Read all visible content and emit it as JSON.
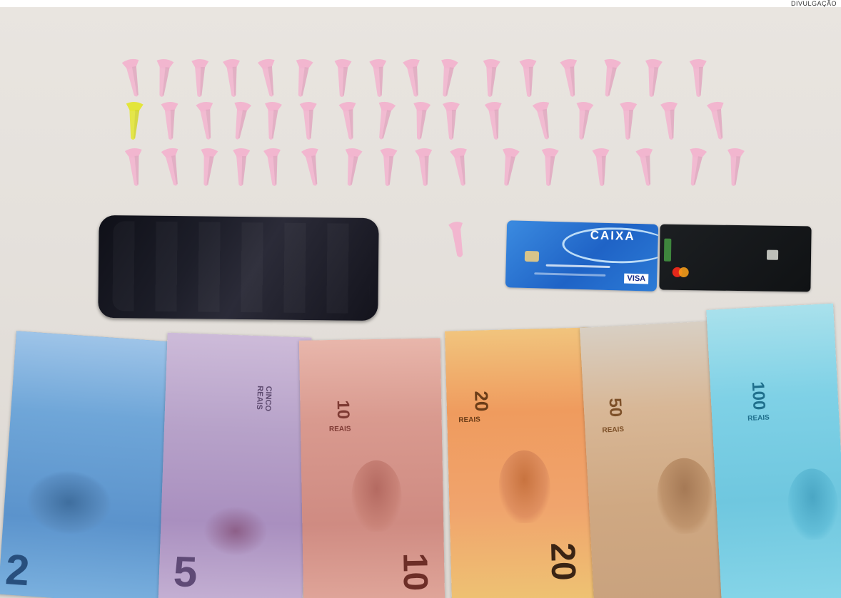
{
  "photo_credit": "DIVULGAÇÃO",
  "caixa_card": {
    "brand": "CAIXA",
    "network": "VISA"
  },
  "banknotes": [
    {
      "denomination": "2",
      "color": "#6fa6d8"
    },
    {
      "denomination": "5",
      "color": "#b7a2c9",
      "side_text": "CINCO REAIS"
    },
    {
      "denomination": "10",
      "color": "#d99a8f",
      "label": "REAIS"
    },
    {
      "denomination": "20",
      "color": "#ef9b5e",
      "label": "REAIS"
    },
    {
      "denomination": "50",
      "color": "#d8b796",
      "label": "REAIS"
    },
    {
      "denomination": "100",
      "color": "#7fd1e6",
      "label": "REAIS"
    }
  ],
  "colors": {
    "table_surface": "#e6e2dd",
    "packet_pink": "#f2b6cf",
    "packet_yellow": "#e3e53a",
    "phone_black": "#15161f",
    "card_blue": "#2c73d1"
  }
}
